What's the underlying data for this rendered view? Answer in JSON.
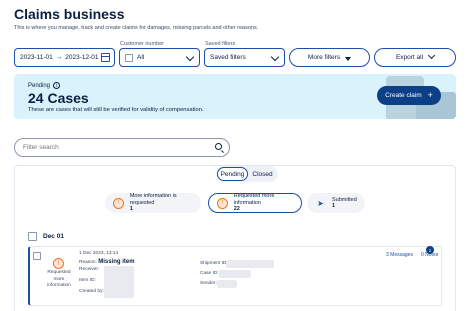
{
  "header": {
    "title": "Claims business",
    "subtitle": "This is where you manage, track and create claims for damages, missing parcels and other reasons."
  },
  "filters": {
    "date_from": "2023-11-01",
    "date_arrow": "→",
    "date_to": "2023-12-01",
    "customer_label": "Customer number",
    "customer_value": "All",
    "saved_label": "Saved filters",
    "saved_value": "Saved filters",
    "more_filters": "More filters",
    "export": "Export all"
  },
  "banner": {
    "pending_label": "Pending",
    "count": "24 Cases",
    "description": "These are cases that will still be verified for validity of compensation.",
    "create_label": "Create claim",
    "create_icon": "+"
  },
  "search": {
    "placeholder": "Filter search"
  },
  "tabs": [
    {
      "label": "Pending",
      "active": true
    },
    {
      "label": "Closed",
      "active": false
    }
  ],
  "stats": [
    {
      "label": "More information is requested",
      "value": "1",
      "icon": "alert-circle-icon"
    },
    {
      "label": "Requested more information",
      "value": "22",
      "icon": "alert-circle-icon"
    },
    {
      "label": "Submitted",
      "value": "1",
      "icon": "send-icon"
    }
  ],
  "group": {
    "date": "Dec 01"
  },
  "claim": {
    "timestamp": "1 Dec 2023, 13:14",
    "reason_label": "Reason:",
    "reason_value": "Missing item",
    "receiver_label": "Receiver:",
    "item_label": "Item ID:",
    "created_label": "Created by:",
    "shipment_label": "Shipment ID:",
    "case_label": "Case ID:",
    "sender_label": "Sender:",
    "state": "Requested more information",
    "messages": "3 Messages",
    "notes": "0 Notes",
    "badge": "1"
  },
  "colors": {
    "primary": "#0b3f88",
    "accent_border": "#1c4fa8",
    "banner_bg": "#d9f2fb",
    "warning": "#e8752a"
  }
}
